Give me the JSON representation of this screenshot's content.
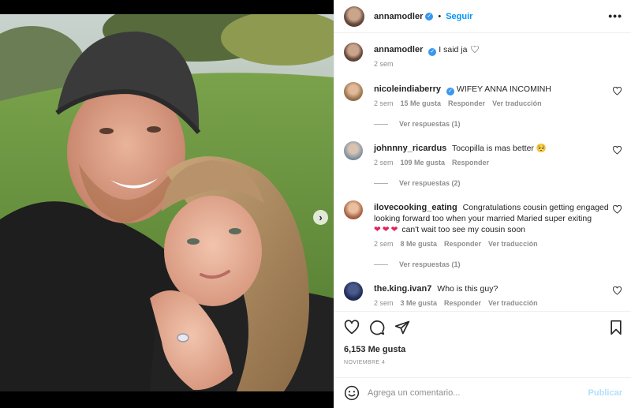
{
  "post": {
    "author": "annamodler",
    "follow_label": "Seguir",
    "separator": "•",
    "more_label": "•••",
    "caption": "I said ja",
    "caption_time": "2 sem"
  },
  "comments": [
    {
      "user": "nicoleindiaberry",
      "verified": true,
      "text": "WIFEY ANNA INCOMINH",
      "time": "2 sem",
      "likes": "15 Me gusta",
      "reply": "Responder",
      "translate": "Ver traducción",
      "view_replies": "Ver respuestas (1)"
    },
    {
      "user": "johnnny_ricardus",
      "text": "Tocopilla is mas better",
      "emoji": "🥺",
      "time": "2 sem",
      "likes": "109 Me gusta",
      "reply": "Responder",
      "view_replies": "Ver respuestas (2)"
    },
    {
      "user": "ilovecooking_eating",
      "text": "Congratulations cousin getting engaged looking forward too when your married Maried super exiting",
      "hearts": "❤❤❤",
      "text2": "can't wait too see my cousin soon",
      "time": "2 sem",
      "likes": "8 Me gusta",
      "reply": "Responder",
      "translate": "Ver traducción",
      "view_replies": "Ver respuestas (1)"
    },
    {
      "user": "the.king.ivan7",
      "text": "Who is this guy?",
      "time": "2 sem",
      "likes": "3 Me gusta",
      "reply": "Responder",
      "translate": "Ver traducción"
    }
  ],
  "actions": {
    "likes": "6,153 Me gusta",
    "date": "NOVIEMBRE 4"
  },
  "add_comment": {
    "placeholder": "Agrega un comentario...",
    "publish_label": "Publicar"
  },
  "carousel": {
    "next_glyph": "›",
    "slide_count": 2,
    "active_slide": 1
  },
  "colors": {
    "accent": "#0095f6",
    "verified": "#3897f0",
    "muted": "#8e8e8e",
    "heart_red": "#e0245e"
  },
  "icons": [
    "like-icon",
    "comment-icon",
    "share-icon",
    "bookmark-icon",
    "emoji-icon",
    "chevron-right-icon"
  ]
}
